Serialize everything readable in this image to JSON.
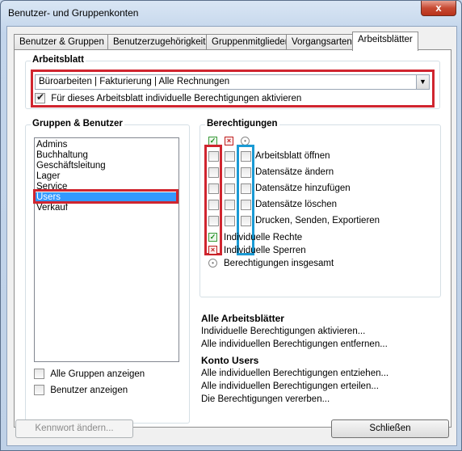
{
  "window": {
    "title": "Benutzer- und Gruppenkonten",
    "close_label": "x"
  },
  "tabs": [
    {
      "label": "Benutzer & Gruppen"
    },
    {
      "label": "Benutzerzugehörigkeit"
    },
    {
      "label": "Gruppenmitglieder"
    },
    {
      "label": "Vorgangsarten"
    },
    {
      "label": "Arbeitsblätter",
      "active": true
    }
  ],
  "arbeitsblatt": {
    "group_title": "Arbeitsblatt",
    "selected": "Büroarbeiten | Fakturierung | Alle Rechnungen",
    "individual_checkbox_label": "Für dieses Arbeitsblatt individuelle Berechtigungen aktivieren",
    "individual_checked": true
  },
  "gruppen": {
    "group_title": "Gruppen & Benutzer",
    "items": [
      "Admins",
      "Buchhaltung",
      "Geschäftsleitung",
      "Lager",
      "Service",
      "Users",
      "Verkauf"
    ],
    "selected_index": 5,
    "show_all_groups_label": "Alle Gruppen anzeigen",
    "show_users_label": "Benutzer anzeigen"
  },
  "berechtigungen": {
    "group_title": "Berechtigungen",
    "column_icons": [
      "check-green-icon",
      "x-red-icon",
      "circle-icon"
    ],
    "rows": [
      "Arbeitsblatt öffnen",
      "Datensätze ändern",
      "Datensätze hinzufügen",
      "Datensätze löschen",
      "Drucken, Senden, Exportieren"
    ],
    "legend": [
      {
        "icon": "check-green-icon",
        "label": "Individuelle Rechte"
      },
      {
        "icon": "x-red-icon",
        "label": "Individuelle Sperren"
      },
      {
        "icon": "circle-icon",
        "label": "Berechtigungen insgesamt"
      }
    ]
  },
  "alle_arbeitsblaetter": {
    "title": "Alle Arbeitsblätter",
    "links": [
      "Individuelle Berechtigungen aktivieren...",
      "Alle individuellen Berechtigungen entfernen..."
    ]
  },
  "konto": {
    "title": "Konto Users",
    "links": [
      "Alle individuellen Berechtigungen entziehen...",
      "Alle individuellen Berechtigungen erteilen...",
      "Die Berechtigungen vererben..."
    ]
  },
  "buttons": {
    "change_password": "Kennwort ändern...",
    "close": "Schließen"
  }
}
